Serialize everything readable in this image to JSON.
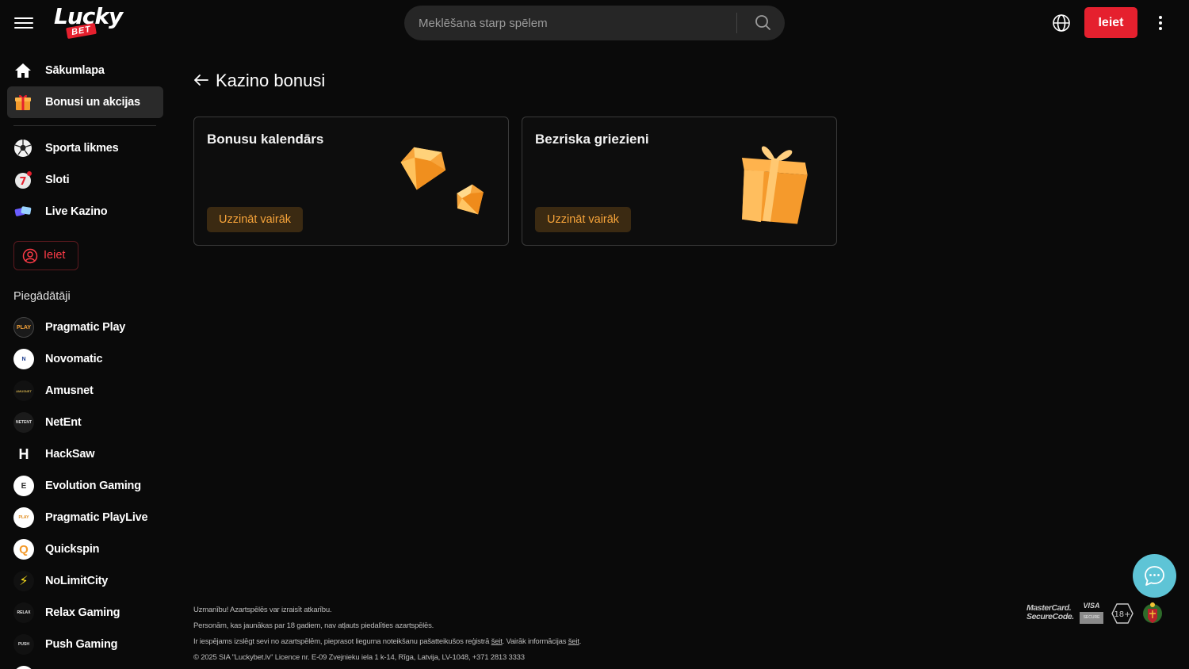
{
  "header": {
    "logo_text": "Lucky",
    "logo_sub": "BET",
    "search_placeholder": "Meklēšana starp spēlem",
    "login_label": "Ieiet"
  },
  "sidebar": {
    "nav": [
      {
        "label": "Sākumlapa",
        "icon": "home-icon"
      },
      {
        "label": "Bonusi un akcijas",
        "icon": "gift-icon",
        "active": true
      },
      {
        "label": "Sporta likmes",
        "icon": "soccer-ball-icon"
      },
      {
        "label": "Sloti",
        "icon": "slot-icon"
      },
      {
        "label": "Live Kazino",
        "icon": "cards-icon"
      }
    ],
    "login_label": "Ieiet",
    "providers_title": "Piegādātāji",
    "providers": [
      {
        "label": "Pragmatic Play",
        "logo_text": "PLAY"
      },
      {
        "label": "Novomatic",
        "logo_text": "N"
      },
      {
        "label": "Amusnet",
        "logo_text": "AMUSNET"
      },
      {
        "label": "NetEnt",
        "logo_text": "NETENT"
      },
      {
        "label": "HackSaw",
        "logo_text": "H"
      },
      {
        "label": "Evolution Gaming",
        "logo_text": "E"
      },
      {
        "label": "Pragmatic PlayLive",
        "logo_text": "PLAY"
      },
      {
        "label": "Quickspin",
        "logo_text": "Q"
      },
      {
        "label": "NoLimitCity",
        "logo_text": "⚡"
      },
      {
        "label": "Relax Gaming",
        "logo_text": "RELAX"
      },
      {
        "label": "Push Gaming",
        "logo_text": "PUSH"
      }
    ]
  },
  "main": {
    "title": "Kazino bonusi",
    "cards": [
      {
        "title": "Bonusu kalendārs",
        "cta": "Uzzināt vairāk",
        "art": "diamond-icon"
      },
      {
        "title": "Bezriska griezieni",
        "cta": "Uzzināt vairāk",
        "art": "gift-box-icon"
      }
    ]
  },
  "footer": {
    "line1": "Uzmanību! Azartspēlēs var izraisīt atkarību.",
    "line2": "Personām, kas jaunākas par 18 gadiem, nav atļauts piedalīties azartspēlēs.",
    "line3_a": "Ir iespējams izslēgt sevi no azartspēlēm, pieprasot lieguma noteikšanu pašatteikušos reģistrā ",
    "line3_link1": "šeit",
    "line3_b": ". Vairāk informācijas ",
    "line3_link2": "šeit",
    "line3_c": ".",
    "line4": "© 2025 SIA \"Luckybet.lv\" Licence nr. E-09 Zvejnieku iela 1 k-14, Rīga, Latvija, LV-1048, +371 2813 3333",
    "badges": {
      "mastercard_1": "MasterCard.",
      "mastercard_2": "SecureCode.",
      "visa": "VISA",
      "visa_sub": "SECURE",
      "age": "18+"
    }
  },
  "colors": {
    "accent": "#e5202e",
    "cta_text": "#f7a43a",
    "cta_bg": "#3b2a12",
    "chat": "#5ec4d6"
  }
}
